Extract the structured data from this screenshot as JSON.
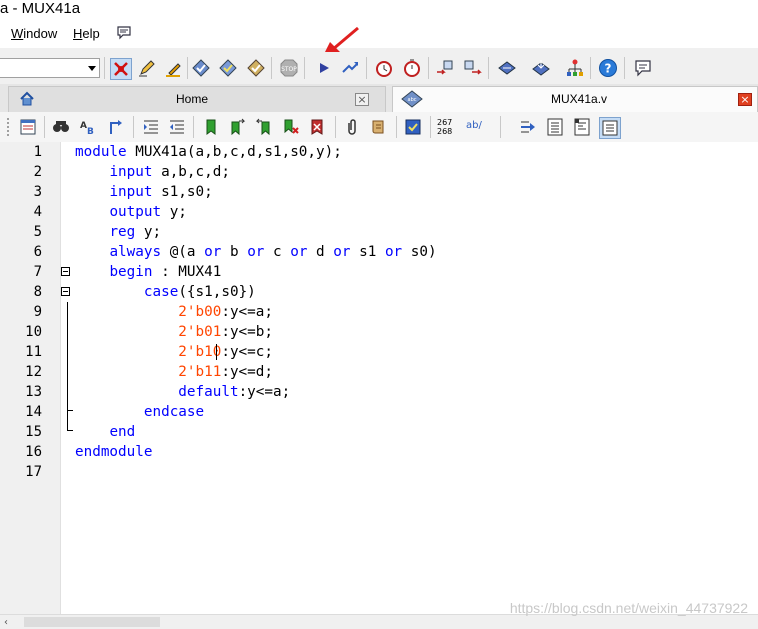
{
  "window": {
    "title": "a - MUX41a"
  },
  "menu": [
    {
      "label": "Window",
      "underline": "W",
      "rest": "indow"
    },
    {
      "label": "Help",
      "underline": "H",
      "rest": "elp"
    }
  ],
  "toolbar_top": {
    "icons": [
      "stop-red-x-icon",
      "pencil-icon",
      "highlight-pen-icon",
      "compile-icon",
      "analysis-icon",
      "synthesis-icon",
      "stop-icon",
      "play-icon",
      "play-step-icon",
      "clock-icon",
      "stopwatch-icon",
      "chip-in-icon",
      "chip-out-icon",
      "program-icon",
      "download-icon",
      "netlist-icon",
      "help-icon",
      "comment-icon"
    ]
  },
  "tabs": [
    {
      "label": "Home",
      "active": false,
      "icon": "home-icon"
    },
    {
      "label": "MUX41a.v",
      "active": true,
      "icon": "verilog-file-icon"
    }
  ],
  "toolbar_editor": {
    "labels": [
      "267\n268",
      "ab/"
    ]
  },
  "editor": {
    "line_numbers": [
      "1",
      "2",
      "3",
      "4",
      "5",
      "6",
      "7",
      "8",
      "9",
      "10",
      "11",
      "12",
      "13",
      "14",
      "15",
      "16",
      "17"
    ],
    "lines": [
      [
        {
          "t": "module",
          "k": "kw"
        },
        {
          "t": " MUX41a(a,b,c,d,s1,s0,y);"
        }
      ],
      [
        {
          "t": "    "
        },
        {
          "t": "input",
          "k": "kw"
        },
        {
          "t": " a,b,c,d;"
        }
      ],
      [
        {
          "t": "    "
        },
        {
          "t": "input",
          "k": "kw"
        },
        {
          "t": " s1,s0;"
        }
      ],
      [
        {
          "t": "    "
        },
        {
          "t": "output",
          "k": "kw"
        },
        {
          "t": " y;"
        }
      ],
      [
        {
          "t": "    "
        },
        {
          "t": "reg",
          "k": "kw"
        },
        {
          "t": " y;"
        }
      ],
      [
        {
          "t": "    "
        },
        {
          "t": "always",
          "k": "kw"
        },
        {
          "t": " @(a "
        },
        {
          "t": "or",
          "k": "kw"
        },
        {
          "t": " b "
        },
        {
          "t": "or",
          "k": "kw"
        },
        {
          "t": " c "
        },
        {
          "t": "or",
          "k": "kw"
        },
        {
          "t": " d "
        },
        {
          "t": "or",
          "k": "kw"
        },
        {
          "t": " s1 "
        },
        {
          "t": "or",
          "k": "kw"
        },
        {
          "t": " s0)"
        }
      ],
      [
        {
          "t": "    "
        },
        {
          "t": "begin",
          "k": "kw"
        },
        {
          "t": " : MUX41"
        }
      ],
      [
        {
          "t": "        "
        },
        {
          "t": "case",
          "k": "kw"
        },
        {
          "t": "({s1,s0})"
        }
      ],
      [
        {
          "t": "            "
        },
        {
          "t": "2'b00",
          "k": "num"
        },
        {
          "t": ":y<=a;"
        }
      ],
      [
        {
          "t": "            "
        },
        {
          "t": "2'b01",
          "k": "num"
        },
        {
          "t": ":y<=b;"
        }
      ],
      [
        {
          "t": "            "
        },
        {
          "t": "2'b10",
          "k": "num"
        },
        {
          "t": ":y<=c;"
        }
      ],
      [
        {
          "t": "            "
        },
        {
          "t": "2'b11",
          "k": "num"
        },
        {
          "t": ":y<=d;"
        }
      ],
      [
        {
          "t": "            "
        },
        {
          "t": "default",
          "k": "kw"
        },
        {
          "t": ":y<=a;"
        }
      ],
      [
        {
          "t": "        "
        },
        {
          "t": "endcase",
          "k": "kw"
        }
      ],
      [
        {
          "t": "    "
        },
        {
          "t": "end",
          "k": "kw"
        }
      ],
      [
        {
          "t": "endmodule",
          "k": "kw"
        }
      ],
      []
    ],
    "fold_lines": [
      7,
      8
    ],
    "colors": {
      "keyword": "#0000ff",
      "number": "#ff4500",
      "text": "#000000"
    }
  },
  "watermark": "https://blog.csdn.net/weixin_44737922"
}
